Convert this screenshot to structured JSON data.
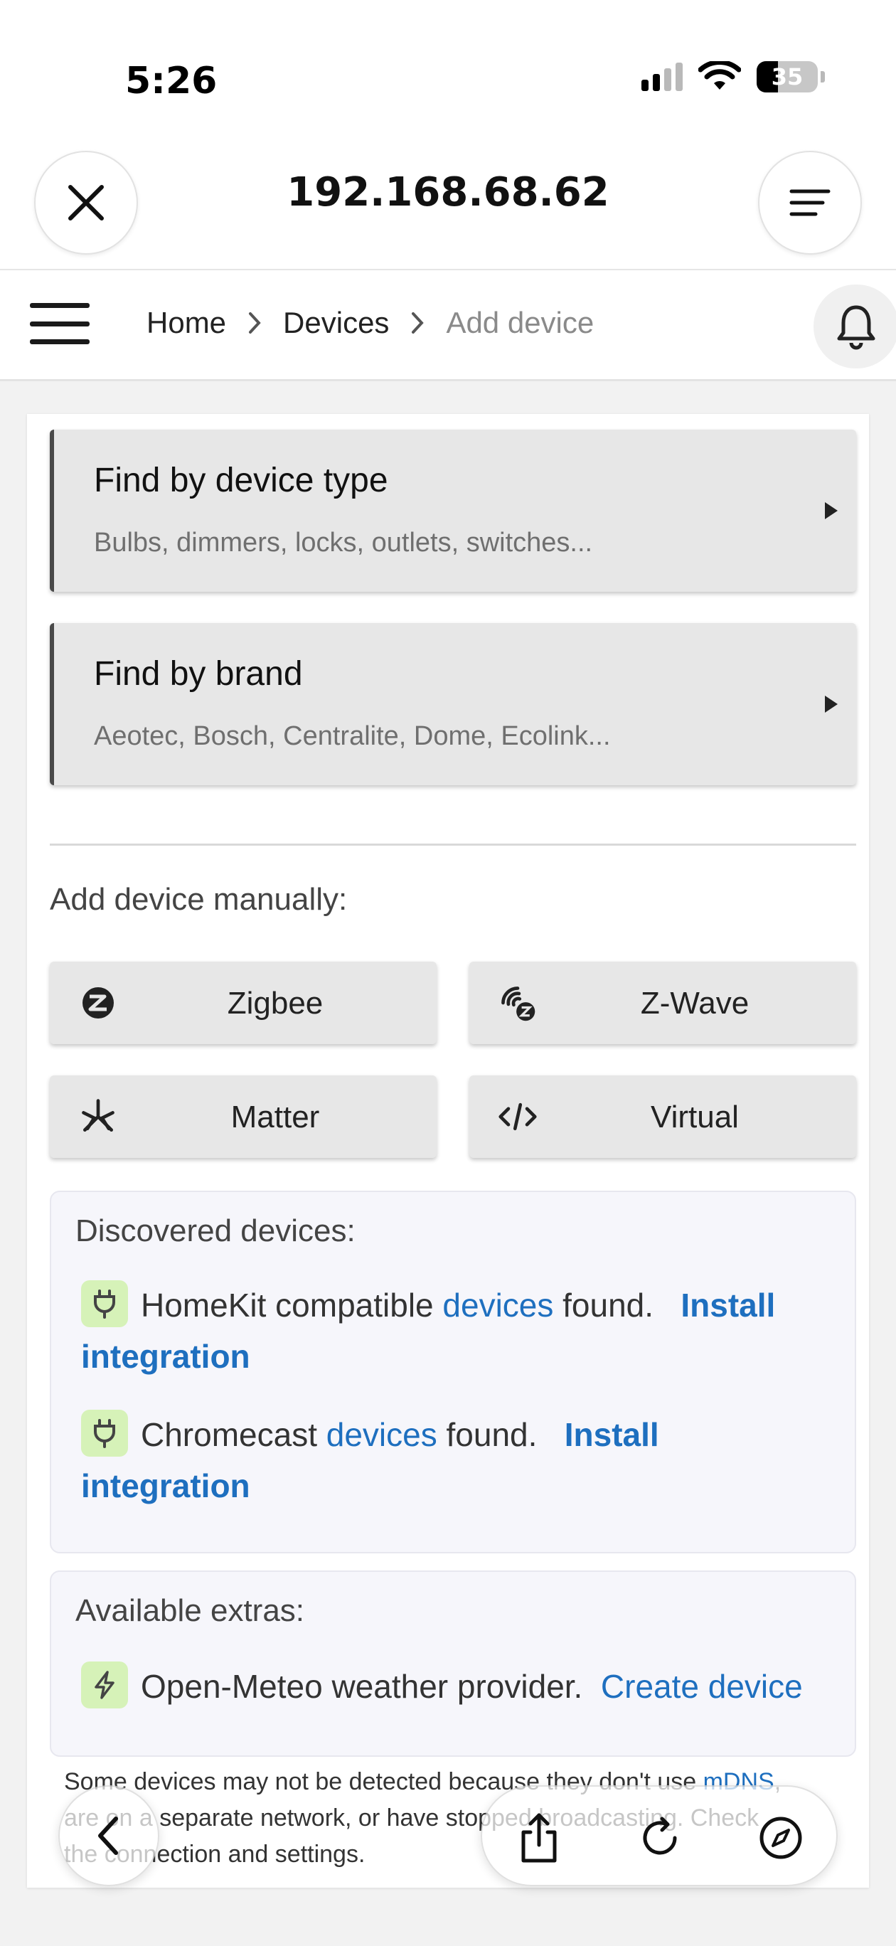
{
  "status_bar": {
    "time": "5:26",
    "battery": "35",
    "battery_level": 0.35,
    "icons": [
      "signal-icon",
      "wifi-icon",
      "battery-icon"
    ]
  },
  "browser": {
    "url": "192.168.68.62",
    "close_icon": "close-icon",
    "menu_icon": "menu-lines-icon"
  },
  "toolbar": {
    "breadcrumbs": [
      "Home",
      "Devices",
      "Add device"
    ],
    "bell_icon": "bell-icon"
  },
  "find_cards": [
    {
      "title": "Find by device type",
      "subtitle": "Bulbs, dimmers, locks, outlets, switches..."
    },
    {
      "title": "Find by brand",
      "subtitle": "Aeotec, Bosch, Centralite, Dome, Ecolink..."
    }
  ],
  "manual": {
    "label": "Add device manually:",
    "buttons": [
      {
        "label": "Zigbee",
        "icon": "zigbee-icon"
      },
      {
        "label": "Z-Wave",
        "icon": "zwave-icon"
      },
      {
        "label": "Matter",
        "icon": "matter-icon"
      },
      {
        "label": "Virtual",
        "icon": "code-icon"
      }
    ]
  },
  "discovered": {
    "title": "Discovered devices:",
    "items": [
      {
        "prefix": "HomeKit compatible",
        "link": "devices",
        "suffix": "found.",
        "action": "Install integration"
      },
      {
        "prefix": "Chromecast",
        "link": "devices",
        "suffix": "found.",
        "action": "Install integration"
      }
    ]
  },
  "extras": {
    "title": "Available extras:",
    "item": {
      "text": "Open-Meteo weather provider.",
      "action": "Create device"
    }
  },
  "footer_note": {
    "line1_start": "Some devices may not be detected because they don't use ",
    "line1_link": "mDNS",
    "line1_end": ",",
    "line2": "are on a separate network, or have stopped broadcasting. Check",
    "line3": "the connection and settings."
  },
  "colors": {
    "accent": "#1e6fbf",
    "card_bg": "#e7e7e7",
    "badge_bg": "#d6f2b8"
  }
}
